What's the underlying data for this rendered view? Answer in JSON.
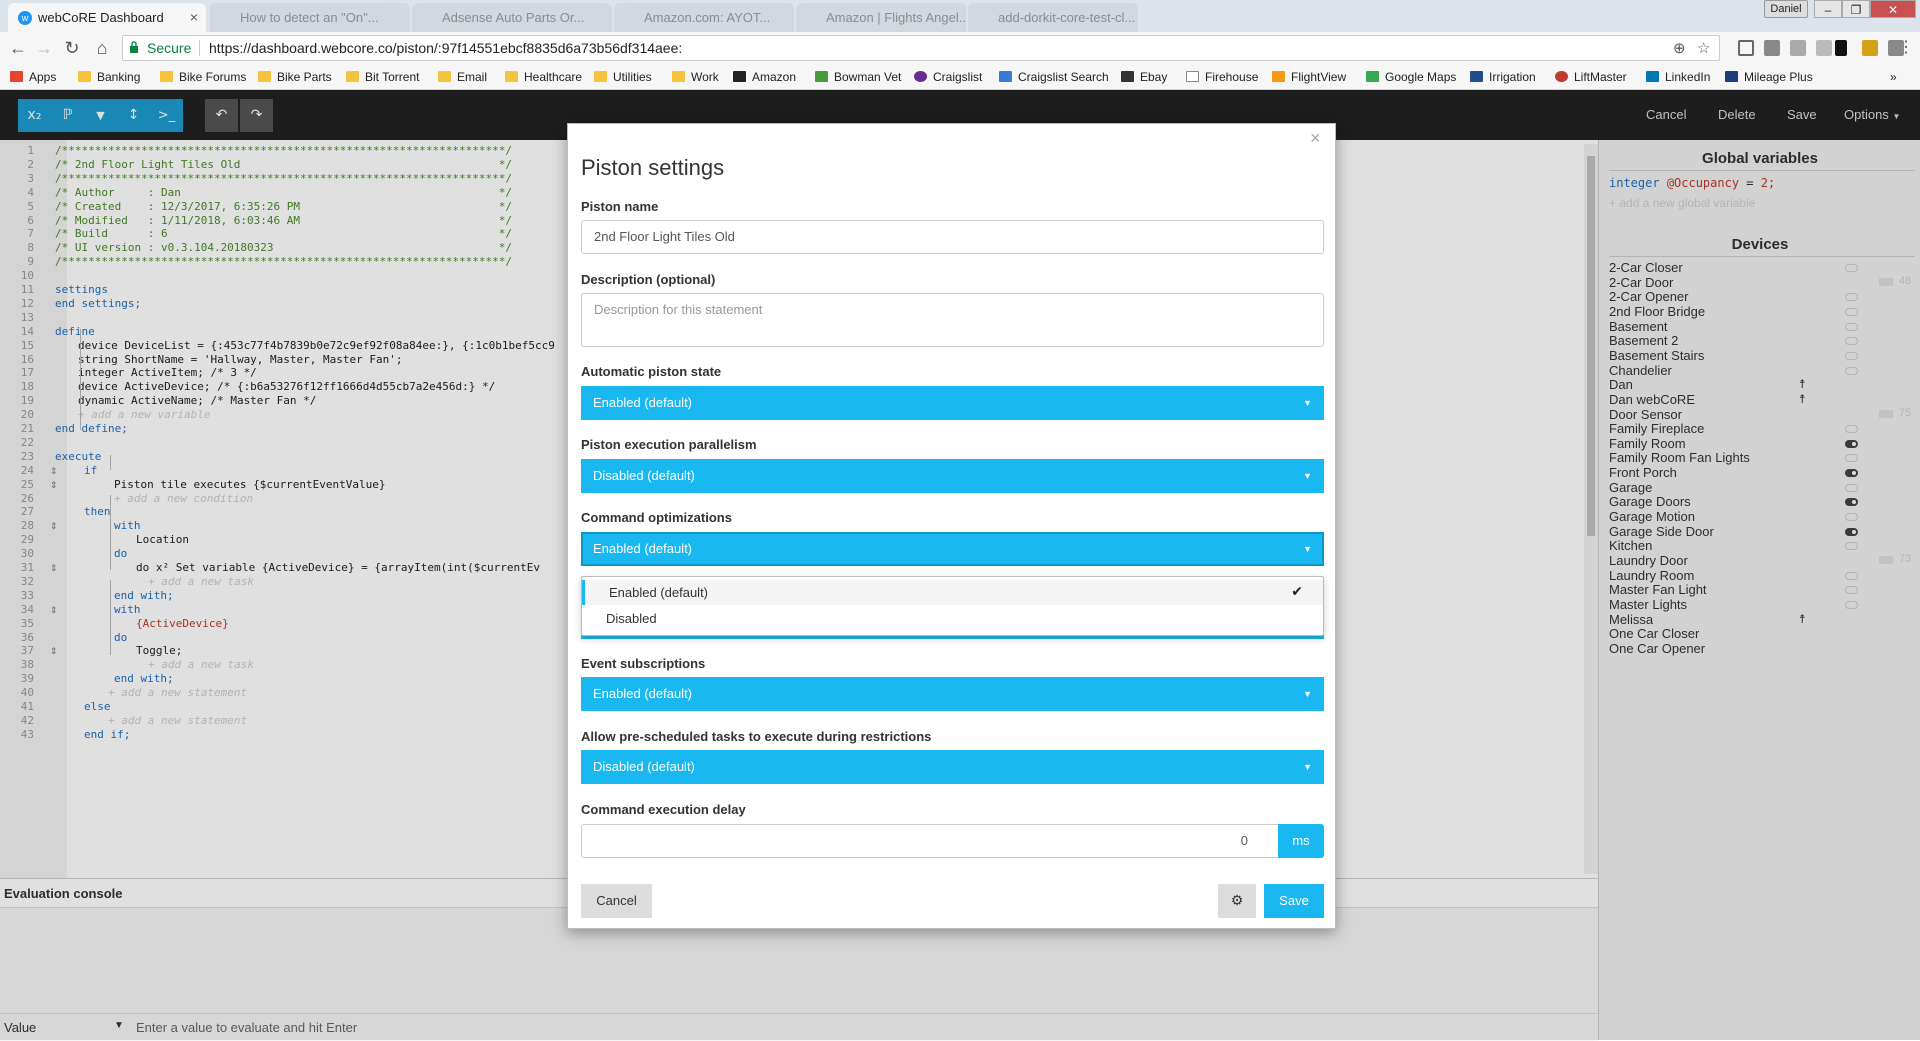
{
  "browser": {
    "active_tab": "webCoRE Dashboard",
    "inactive_tabs": [
      "How to detect an \"On\"...",
      "Adsense Auto Parts Or...",
      "Amazon.com: AYOT...",
      "Amazon | Flights Angel...",
      "add-dorkit-core-test-cl..."
    ],
    "user": "Daniel",
    "secure_label": "Secure",
    "url": "https://dashboard.webcore.co/piston/:97f14551ebcf8835d6a73b56df314aee:"
  },
  "bookmarks": [
    {
      "label": "Apps",
      "color": "#e8442c"
    },
    {
      "label": "Banking",
      "color": "#f5c43c"
    },
    {
      "label": "Bike Forums",
      "color": "#f5c43c"
    },
    {
      "label": "Bike Parts",
      "color": "#f5c43c"
    },
    {
      "label": "Bit Torrent",
      "color": "#f5c43c"
    },
    {
      "label": "Email",
      "color": "#f5c43c"
    },
    {
      "label": "Healthcare",
      "color": "#f5c43c"
    },
    {
      "label": "Utilities",
      "color": "#f5c43c"
    },
    {
      "label": "Work",
      "color": "#f5c43c"
    },
    {
      "label": "Amazon",
      "color": "#222222"
    },
    {
      "label": "Bowman Vet",
      "color": "#4a9b3c"
    },
    {
      "label": "Craigslist",
      "color": "#6a2c91"
    },
    {
      "label": "Craigslist Search",
      "color": "#3a7bd5"
    },
    {
      "label": "Ebay",
      "color": "#333333"
    },
    {
      "label": "Firehouse",
      "color": "#888888"
    },
    {
      "label": "FlightView",
      "color": "#f39c12"
    },
    {
      "label": "Google Maps",
      "color": "#34a853"
    },
    {
      "label": "Irrigation",
      "color": "#1e4f8a"
    },
    {
      "label": "LiftMaster",
      "color": "#c0392b"
    },
    {
      "label": "LinkedIn",
      "color": "#0077b5"
    },
    {
      "label": "Mileage Plus",
      "color": "#1a3d7c"
    }
  ],
  "toolbar": {
    "buttons": [
      "x₂",
      "ℙ",
      "▼",
      "↕",
      ">_",
      "↶",
      "↷"
    ],
    "cancel": "Cancel",
    "delete": "Delete",
    "save": "Save",
    "options": "Options"
  },
  "code_lines": [
    "/*******************************************************************/",
    "/* 2nd Floor Light Tiles Old                                       */",
    "/*******************************************************************/",
    "/* Author     : Dan                                                */",
    "/* Created    : 12/3/2017, 6:35:26 PM                              */",
    "/* Modified   : 1/11/2018, 6:03:46 AM                              */",
    "/* Build      : 6                                                  */",
    "/* UI version : v0.3.104.20180323                                  */",
    "/*******************************************************************/",
    "",
    "settings",
    "end settings;",
    "",
    "define",
    "device DeviceList = {:453c77f4b7839b0e72c9ef92f08a84ee:}, {:1c0b1bef5cc9",
    "string ShortName = 'Hallway, Master, Master Fan';",
    "integer ActiveItem; /* 3 */",
    "device ActiveDevice; /* {:b6a53276f12ff1666d4d55cb7a2e456d:} */",
    "dynamic ActiveName; /* Master Fan */",
    "+ add a new variable",
    "end define;",
    "",
    "execute",
    "if",
    "Piston tile executes {$currentEventValue}",
    "+ add a new condition",
    "then",
    "with",
    "Location",
    "do",
    "do x² Set variable {ActiveDevice} = {arrayItem(int($currentEv",
    "+ add a new task",
    "end with;",
    "with",
    "{ActiveDevice}",
    "do",
    "Toggle;",
    "+ add a new task",
    "end with;",
    "+ add a new statement",
    "else",
    "+ add a new statement",
    "end if;"
  ],
  "console": {
    "title": "Evaluation console",
    "value_label": "Value",
    "input_placeholder": "Enter a value to evaluate and hit Enter"
  },
  "right_panel": {
    "globals_title": "Global variables",
    "global_var": {
      "type": "integer",
      "name": "@Occupancy",
      "value": "2;"
    },
    "add_global": "+ add a new global variable",
    "devices_title": "Devices",
    "devices": [
      {
        "name": "2-Car Closer",
        "state": "off"
      },
      {
        "name": "2-Car Door",
        "state": "meter",
        "meter": "48"
      },
      {
        "name": "2-Car Opener",
        "state": "off"
      },
      {
        "name": "2nd Floor Bridge",
        "state": "off"
      },
      {
        "name": "Basement",
        "state": "off"
      },
      {
        "name": "Basement 2",
        "state": "off"
      },
      {
        "name": "Basement Stairs",
        "state": "off"
      },
      {
        "name": "Chandelier",
        "state": "off"
      },
      {
        "name": "Dan",
        "state": "person"
      },
      {
        "name": "Dan webCoRE",
        "state": "person"
      },
      {
        "name": "Door Sensor",
        "state": "meter",
        "meter": "75"
      },
      {
        "name": "Family Fireplace",
        "state": "off"
      },
      {
        "name": "Family Room",
        "state": "on"
      },
      {
        "name": "Family Room Fan Lights",
        "state": "off"
      },
      {
        "name": "Front Porch",
        "state": "on"
      },
      {
        "name": "Garage",
        "state": "off"
      },
      {
        "name": "Garage Doors",
        "state": "on"
      },
      {
        "name": "Garage Motion",
        "state": "off"
      },
      {
        "name": "Garage Side Door",
        "state": "on"
      },
      {
        "name": "Kitchen",
        "state": "off"
      },
      {
        "name": "Laundry Door",
        "state": "meter",
        "meter": "73"
      },
      {
        "name": "Laundry Room",
        "state": "off"
      },
      {
        "name": "Master Fan Light",
        "state": "off"
      },
      {
        "name": "Master Lights",
        "state": "off"
      },
      {
        "name": "Melissa",
        "state": "person"
      },
      {
        "name": "One Car Closer",
        "state": "none"
      },
      {
        "name": "One Car Opener",
        "state": "none"
      }
    ]
  },
  "modal": {
    "title": "Piston settings",
    "close": "×",
    "piston_name_label": "Piston name",
    "piston_name_value": "2nd Floor Light Tiles Old",
    "description_label": "Description (optional)",
    "description_placeholder": "Description for this statement",
    "auto_state_label": "Automatic piston state",
    "auto_state_value": "Enabled (default)",
    "parallelism_label": "Piston execution parallelism",
    "parallelism_value": "Disabled (default)",
    "cmd_opt_label": "Command optimizations",
    "cmd_opt_value": "Enabled (default)",
    "cmd_opt_options": [
      "Enabled (default)",
      "Disabled"
    ],
    "event_sub_label": "Event subscriptions",
    "event_sub_value": "Enabled (default)",
    "prescheduled_label": "Allow pre-scheduled tasks to execute during restrictions",
    "prescheduled_value": "Disabled (default)",
    "delay_label": "Command execution delay",
    "delay_value": "0",
    "delay_unit": "ms",
    "cancel": "Cancel",
    "save": "Save"
  },
  "colors": {
    "accent": "#1ab8f1",
    "toolbar_bg": "#222222",
    "toolbar_blue": "#1d9bd1"
  }
}
